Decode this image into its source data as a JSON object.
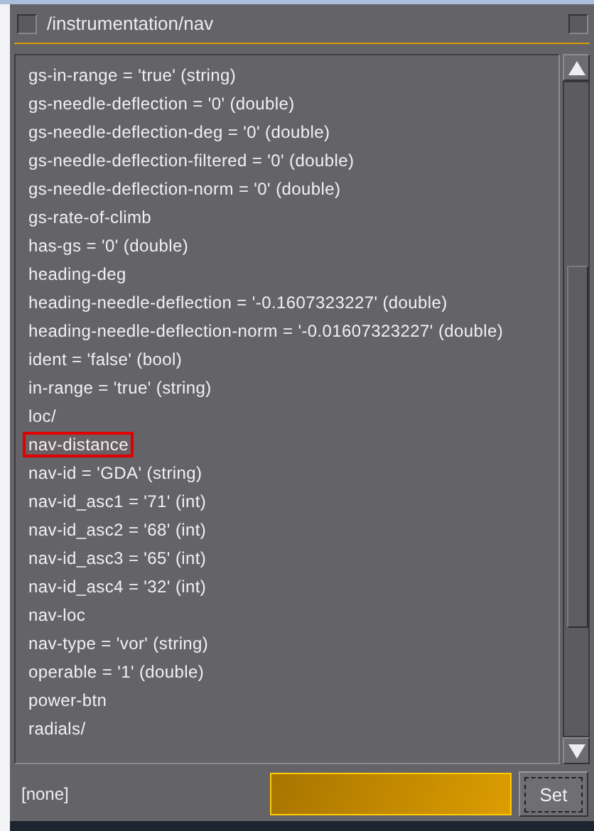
{
  "window": {
    "title": "/instrumentation/nav",
    "checked": false
  },
  "properties": [
    {
      "text": "gs-in-range = 'true' (string)",
      "highlighted": false
    },
    {
      "text": "gs-needle-deflection = '0' (double)",
      "highlighted": false
    },
    {
      "text": "gs-needle-deflection-deg = '0' (double)",
      "highlighted": false
    },
    {
      "text": "gs-needle-deflection-filtered = '0' (double)",
      "highlighted": false
    },
    {
      "text": "gs-needle-deflection-norm = '0' (double)",
      "highlighted": false
    },
    {
      "text": "gs-rate-of-climb",
      "highlighted": false
    },
    {
      "text": "has-gs = '0' (double)",
      "highlighted": false
    },
    {
      "text": "heading-deg",
      "highlighted": false
    },
    {
      "text": "heading-needle-deflection = '-0.1607323227' (double)",
      "highlighted": false
    },
    {
      "text": "heading-needle-deflection-norm = '-0.01607323227' (double)",
      "highlighted": false
    },
    {
      "text": "ident = 'false' (bool)",
      "highlighted": false
    },
    {
      "text": "in-range = 'true' (string)",
      "highlighted": false
    },
    {
      "text": "loc/",
      "highlighted": false
    },
    {
      "text": "nav-distance",
      "highlighted": true
    },
    {
      "text": "nav-id = 'GDA' (string)",
      "highlighted": false
    },
    {
      "text": "nav-id_asc1 = '71' (int)",
      "highlighted": false
    },
    {
      "text": "nav-id_asc2 = '68' (int)",
      "highlighted": false
    },
    {
      "text": "nav-id_asc3 = '65' (int)",
      "highlighted": false
    },
    {
      "text": "nav-id_asc4 = '32' (int)",
      "highlighted": false
    },
    {
      "text": "nav-loc",
      "highlighted": false
    },
    {
      "text": "nav-type = 'vor' (string)",
      "highlighted": false
    },
    {
      "text": "operable = '1' (double)",
      "highlighted": false
    },
    {
      "text": "power-btn",
      "highlighted": false
    },
    {
      "text": "radials/",
      "highlighted": false
    }
  ],
  "status": {
    "label": "[none]"
  },
  "buttons": [
    {
      "label": "Set"
    }
  ]
}
